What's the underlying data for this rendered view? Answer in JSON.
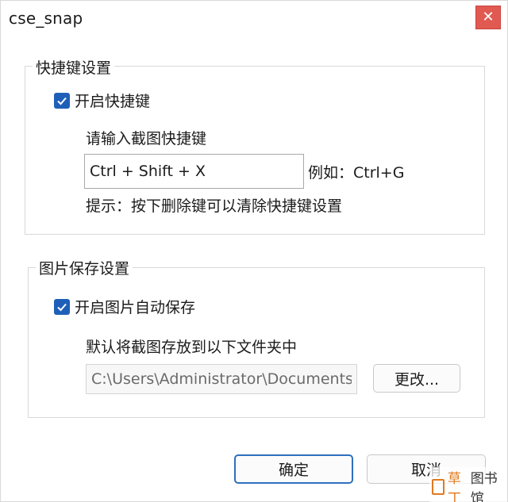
{
  "window": {
    "title": "cse_snap",
    "close_glyph": "✕"
  },
  "shortcut_group": {
    "legend": "快捷键设置",
    "enable_label": "开启快捷键",
    "enable_checked": true,
    "enter_label": "请输入截图快捷键",
    "input_value": "Ctrl + Shift + X",
    "example": "例如：Ctrl+G",
    "hint": "提示：按下删除键可以清除快捷键设置"
  },
  "save_group": {
    "legend": "图片保存设置",
    "enable_label": "开启图片自动保存",
    "enable_checked": true,
    "folder_label": "默认将截图存放到以下文件夹中",
    "path_value": "C:\\Users\\Administrator\\Documents",
    "change_button": "更改..."
  },
  "footer": {
    "ok_button": "确定",
    "cancel_button": "取消"
  },
  "watermark": {
    "brand_accent": "草丁",
    "brand_rest": "图书馆"
  },
  "colors": {
    "accent_blue": "#1f5fb8",
    "close_red": "#e05a52",
    "watermark_orange": "#e07a20"
  }
}
